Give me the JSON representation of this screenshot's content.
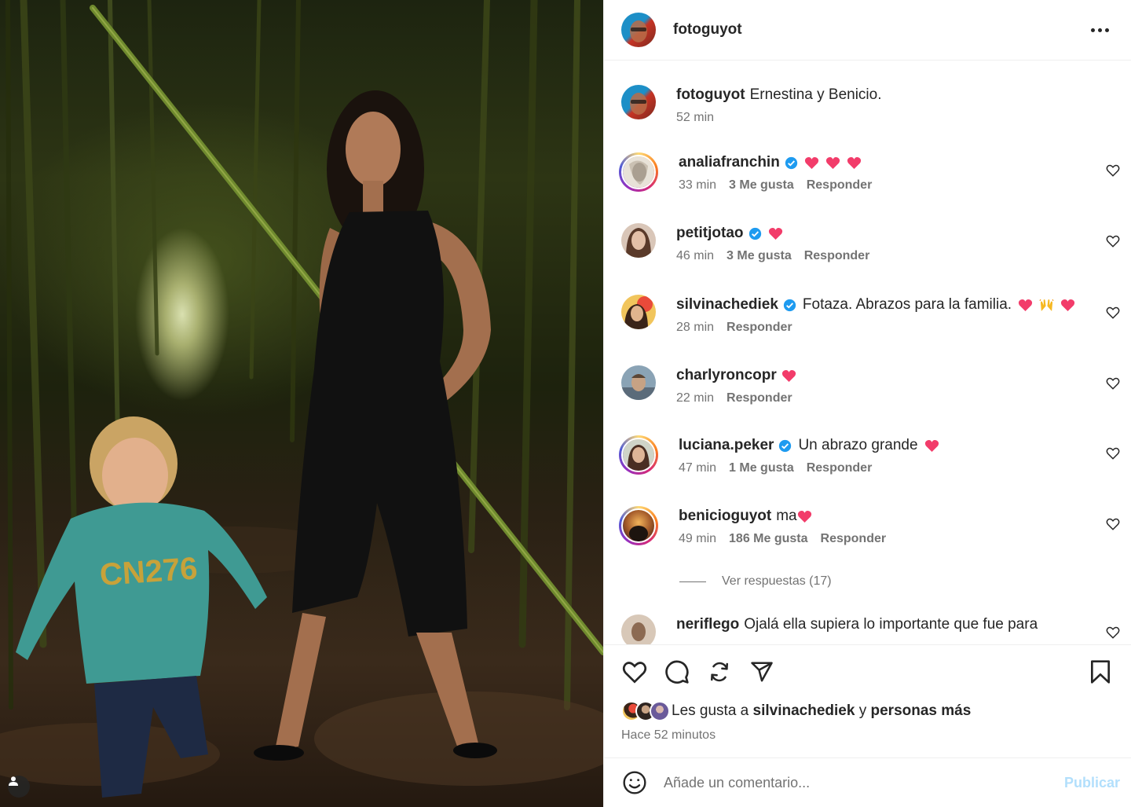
{
  "post": {
    "username": "fotoguyot",
    "more_icon": "more-horizontal-icon"
  },
  "caption": {
    "username": "fotoguyot",
    "text": "Ernestina y Benicio.",
    "time": "52 min"
  },
  "comments": [
    {
      "username": "analiafranchin",
      "verified": true,
      "text": "",
      "emojis": [
        "heart",
        "heart",
        "heart"
      ],
      "time": "33 min",
      "likes": "3 Me gusta",
      "reply": "Responder"
    },
    {
      "username": "petitjotao",
      "verified": true,
      "text": "",
      "emojis": [
        "heart"
      ],
      "time": "46 min",
      "likes": "3 Me gusta",
      "reply": "Responder"
    },
    {
      "username": "silvinachediek",
      "verified": true,
      "text": "Fotaza. Abrazos para la familia.",
      "emojis": [
        "heart",
        "raised-hands",
        "heart"
      ],
      "time": "28 min",
      "likes": "",
      "reply": "Responder"
    },
    {
      "username": "charlyroncopr",
      "verified": false,
      "text": "",
      "emojis": [
        "heart"
      ],
      "time": "22 min",
      "likes": "",
      "reply": "Responder"
    },
    {
      "username": "luciana.peker",
      "verified": true,
      "text": "Un abrazo grande",
      "emojis": [
        "heart"
      ],
      "time": "47 min",
      "likes": "1 Me gusta",
      "reply": "Responder"
    },
    {
      "username": "benicioguyot",
      "verified": false,
      "text": "ma",
      "emojis": [
        "heart"
      ],
      "time": "49 min",
      "likes": "186 Me gusta",
      "reply": "Responder"
    },
    {
      "username": "neriflego",
      "verified": false,
      "text": "Ojalá ella supiera lo importante que fue para",
      "emojis": [],
      "time": "",
      "likes": "",
      "reply": ""
    }
  ],
  "view_replies": "Ver respuestas (17)",
  "likes_line": {
    "prefix": "Les gusta a",
    "user": "silvinachediek",
    "joiner": "y",
    "rest": "personas más"
  },
  "time_ago": "Hace 52 minutos",
  "composer": {
    "placeholder": "Añade un comentario...",
    "publish_label": "Publicar"
  },
  "colors": {
    "like_heart": "#f23c6a",
    "verified": "#1e9bf0",
    "publish_disabled": "#b2dffc",
    "secondary_text": "#737373"
  },
  "icons": [
    "heart-icon",
    "comment-icon",
    "repost-icon",
    "share-icon",
    "bookmark-icon",
    "emoji-icon",
    "user-tag-icon"
  ]
}
